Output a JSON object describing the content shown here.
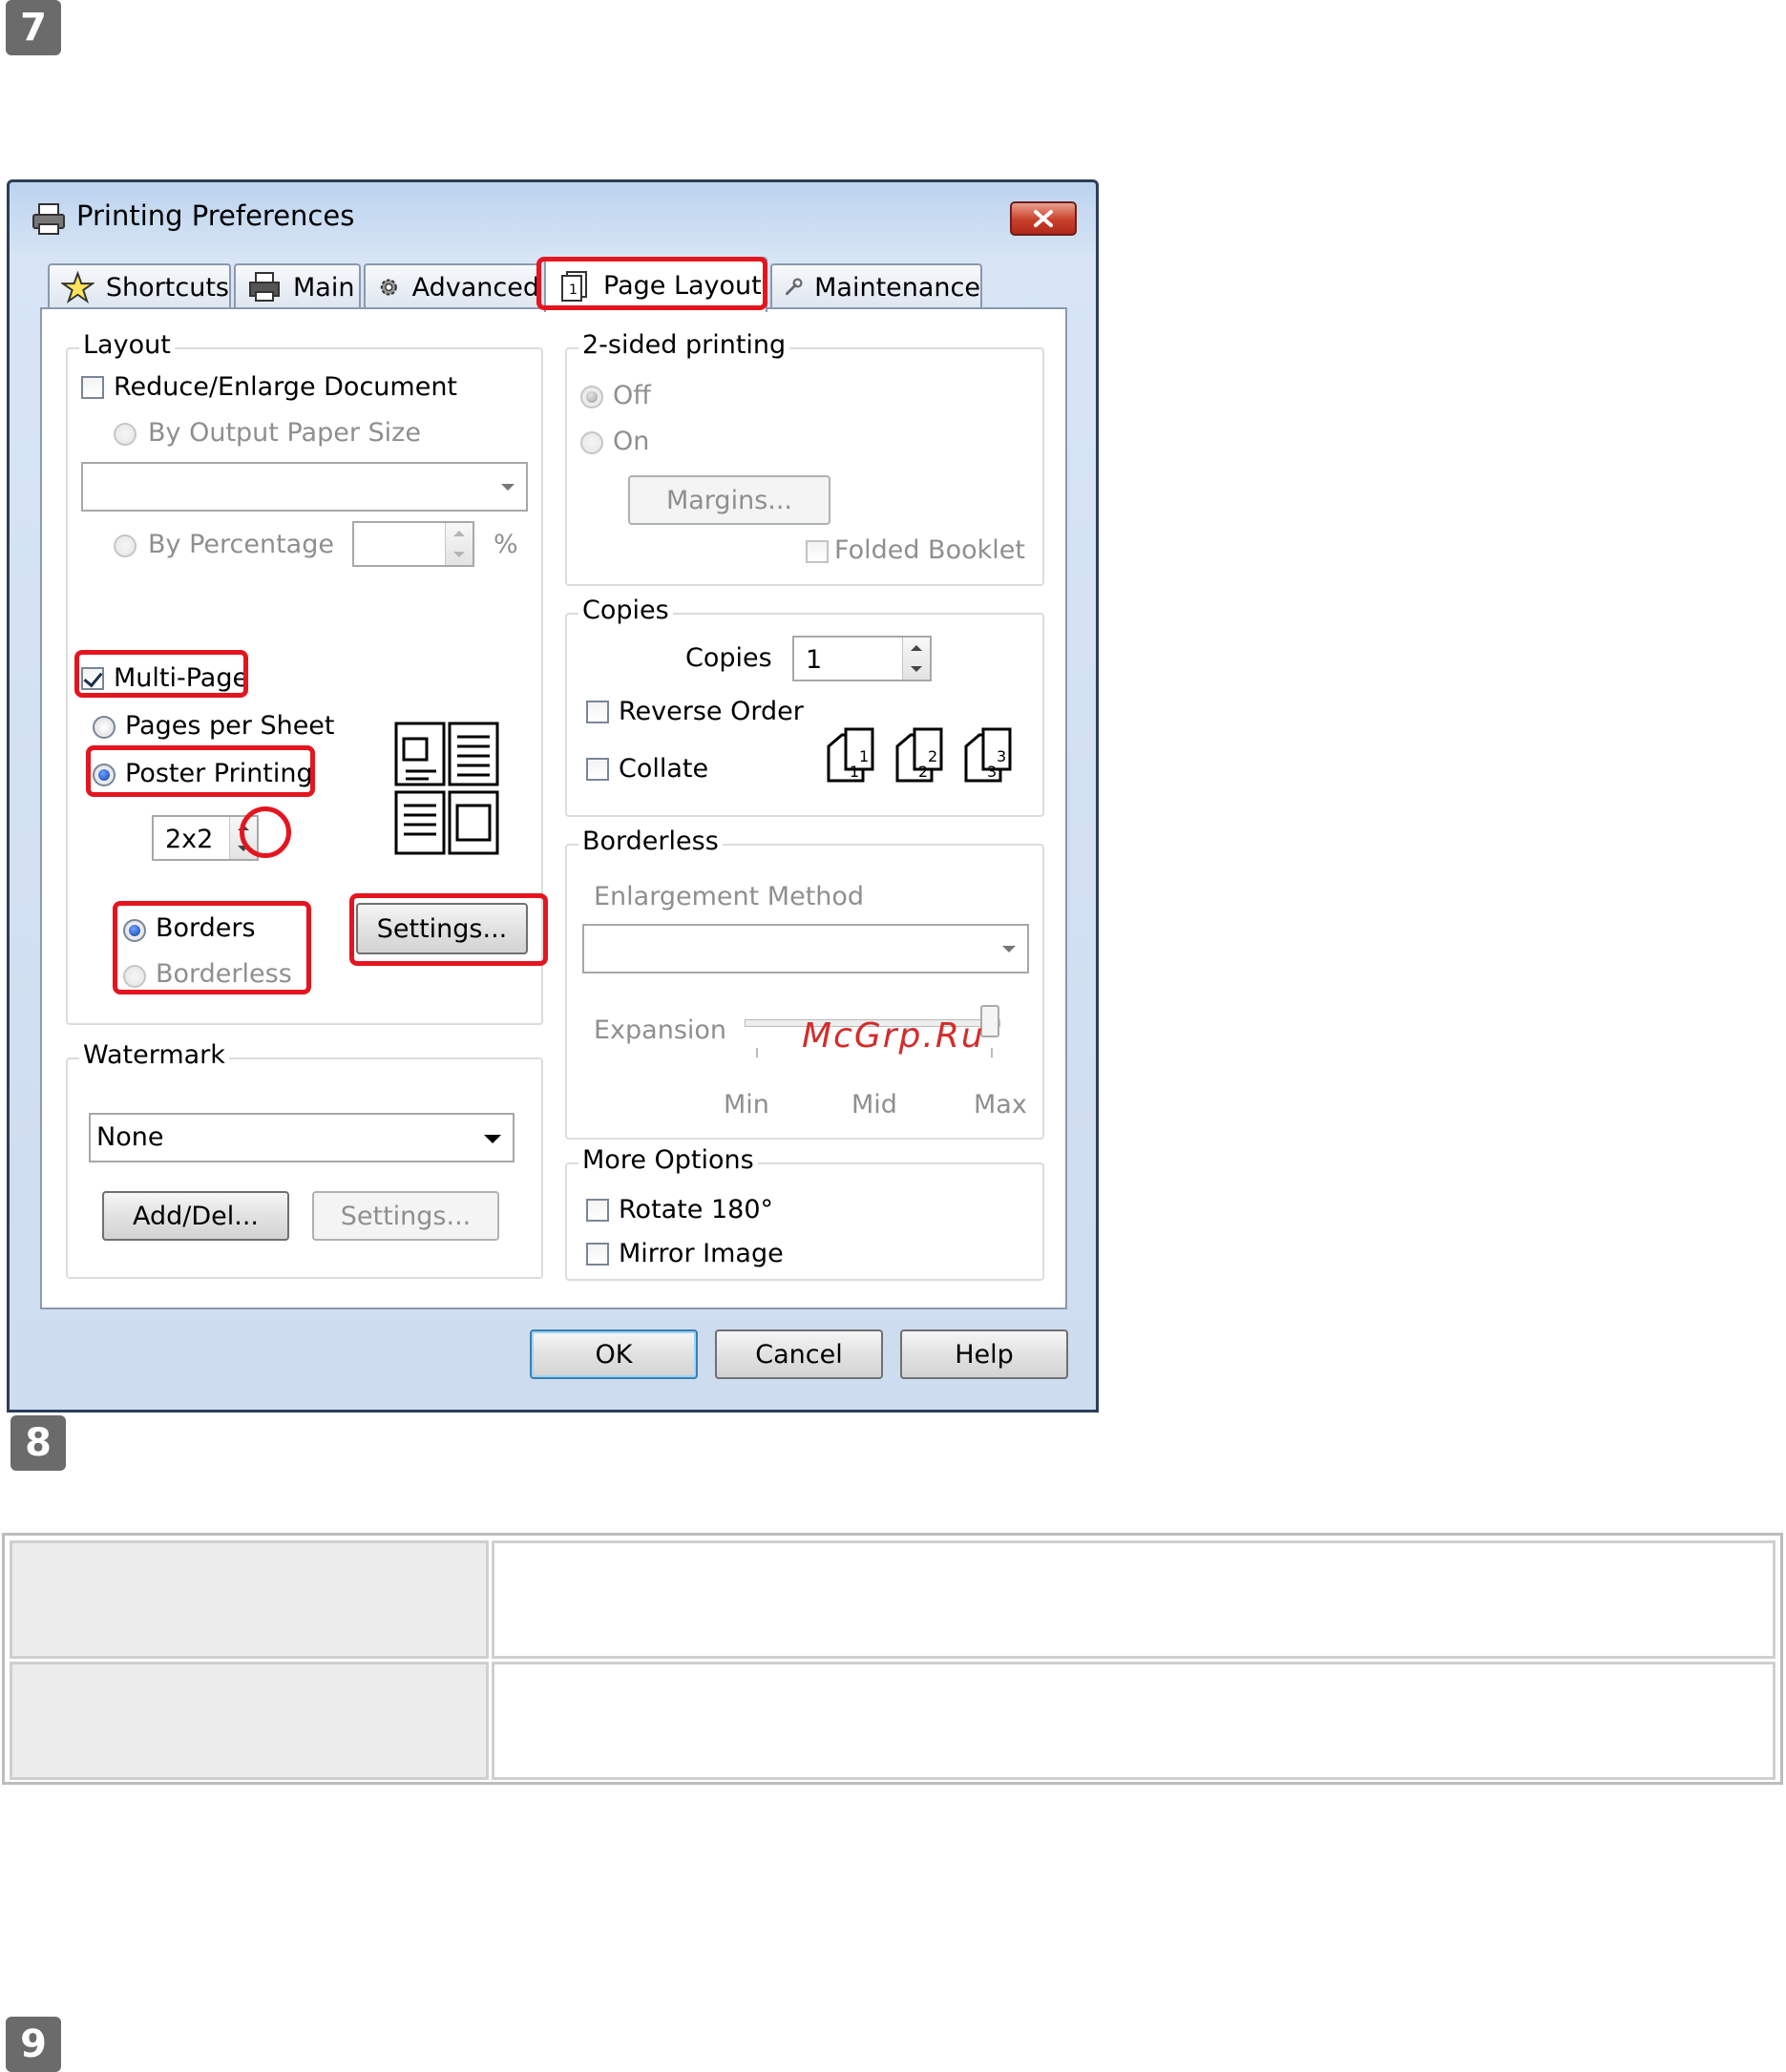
{
  "steps": [
    "7",
    "8",
    "9"
  ],
  "dialog": {
    "title": "Printing Preferences",
    "tabs": [
      "Shortcuts",
      "Main",
      "Advanced",
      "Page Layout",
      "Maintenance"
    ],
    "active_tab": "Page Layout",
    "layout": {
      "legend": "Layout",
      "reduce_enlarge": "Reduce/Enlarge Document",
      "by_output_paper_size": "By Output Paper Size",
      "paper_size_value": "",
      "by_percentage": "By Percentage",
      "percentage_value": "",
      "percent_sign": "%",
      "multi_page": "Multi-Page",
      "pages_per_sheet": "Pages per Sheet",
      "poster_printing": "Poster Printing",
      "poster_size": "2x2",
      "borders": "Borders",
      "borderless": "Borderless",
      "settings": "Settings..."
    },
    "watermark": {
      "legend": "Watermark",
      "value": "None",
      "add_del": "Add/Del...",
      "settings": "Settings..."
    },
    "two_sided": {
      "legend": "2-sided printing",
      "off": "Off",
      "on": "On",
      "margins": "Margins...",
      "folded_booklet": "Folded Booklet"
    },
    "copies": {
      "legend": "Copies",
      "copies_label": "Copies",
      "copies_value": "1",
      "reverse_order": "Reverse Order",
      "collate": "Collate"
    },
    "borderless": {
      "legend": "Borderless",
      "enlargement_method": "Enlargement Method",
      "expansion": "Expansion",
      "min": "Min",
      "mid": "Mid",
      "max": "Max",
      "expansion_level": 1.0
    },
    "more_options": {
      "legend": "More Options",
      "rotate": "Rotate 180°",
      "mirror": "Mirror Image"
    },
    "buttons": {
      "ok": "OK",
      "cancel": "Cancel",
      "help": "Help"
    }
  },
  "watermark_overlay": "McGrp.Ru",
  "colors": {
    "highlight": "#e4151f",
    "title_bar": "#bcd3ee"
  }
}
